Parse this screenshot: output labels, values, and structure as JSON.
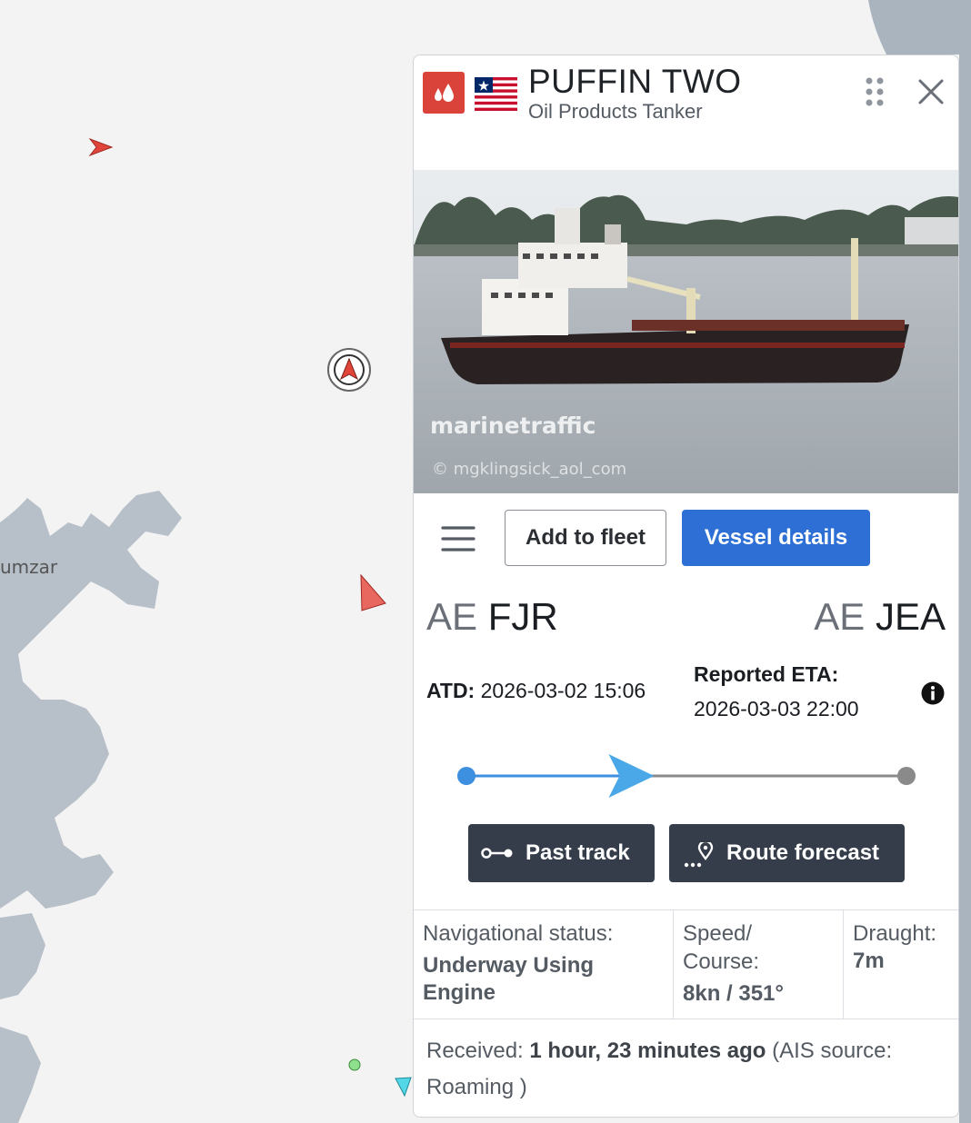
{
  "map": {
    "place_label": "umzar"
  },
  "vessel": {
    "name": "PUFFIN TWO",
    "type": "Oil Products Tanker",
    "type_icon": "oil-drop-icon",
    "flag": "liberia-flag",
    "accent_color": "#d9433a"
  },
  "photo": {
    "watermark": "marinetraffic",
    "credit": "© mgklingsick_aol_com"
  },
  "actions": {
    "add_to_fleet": "Add to fleet",
    "vessel_details": "Vessel details"
  },
  "voyage": {
    "departure": {
      "country": "AE",
      "code": "FJR"
    },
    "arrival": {
      "country": "AE",
      "code": "JEA"
    },
    "atd_label": "ATD:",
    "atd_value": "2026-03-02 15:06",
    "eta_label": "Reported ETA:",
    "eta_value": "2026-03-03 22:00",
    "progress_fraction": 0.41
  },
  "track_buttons": {
    "past_track": "Past track",
    "route_forecast": "Route forecast"
  },
  "status": {
    "nav_label": "Navigational status:",
    "nav_value_line1": "Underway Using",
    "nav_value_line2": "Engine",
    "speed_label_line1": "Speed/",
    "speed_label_line2": "Course:",
    "speed_value": "8kn / 351°",
    "draught_label": "Draught:",
    "draught_value": "7m"
  },
  "received": {
    "label": "Received:",
    "ago": "1 hour, 23 minutes ago",
    "source_prefix": "(AIS source:",
    "source": "Roaming )"
  },
  "colors": {
    "primary_button": "#2d6fd4",
    "dark_button": "#363d4a",
    "progress_done": "#3d8fe0",
    "progress_remaining": "#8a8a8a"
  }
}
